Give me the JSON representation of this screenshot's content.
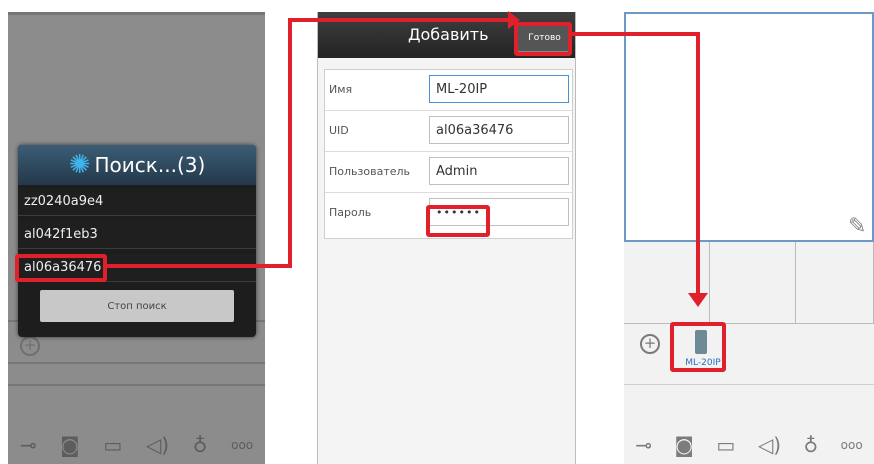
{
  "search_dialog": {
    "title": "Поиск...(3)",
    "results": [
      "zz0240a9e4",
      "al042f1eb3",
      "al06a36476"
    ],
    "stop_button": "Стоп поиск"
  },
  "add_form": {
    "title": "Добавить",
    "done_button": "Готово",
    "fields": [
      {
        "label": "Имя",
        "value": "ML-20IP"
      },
      {
        "label": "UID",
        "value": "al06a36476"
      },
      {
        "label": "Пользователь",
        "value": "Admin"
      },
      {
        "label": "Пароль",
        "value": "••••••"
      }
    ]
  },
  "device_list": {
    "device_label": "ML-20IP"
  },
  "colors": {
    "highlight": "#e0202a",
    "accent": "#2a6fc0"
  }
}
